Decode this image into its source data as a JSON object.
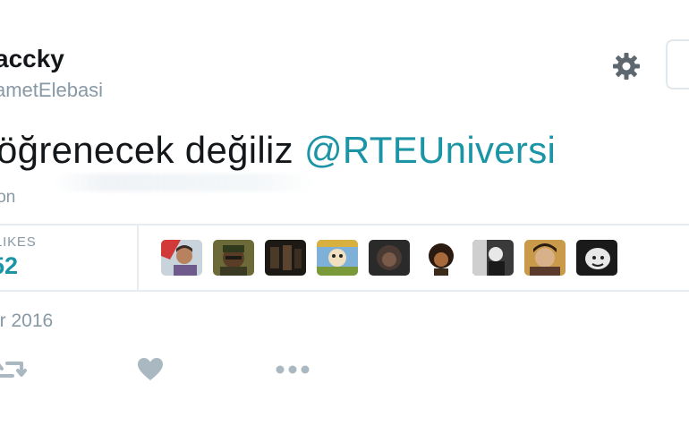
{
  "profile": {
    "display_name": "accky",
    "handle": "ametElebasi"
  },
  "tweet": {
    "text_before": "öğrenecek değiliz ",
    "mention": "@RTEUniversi",
    "translate_label": "ion"
  },
  "stats": {
    "likes_label": "LIKES",
    "likes_count": "52",
    "liker_avatars": [
      "avatar-1",
      "avatar-2",
      "avatar-3",
      "avatar-4",
      "avatar-5",
      "avatar-6",
      "avatar-7",
      "avatar-8",
      "avatar-9"
    ]
  },
  "meta": {
    "date": "or 2016"
  },
  "actions": {
    "icons": [
      "retweet-icon",
      "heart-icon",
      "more-icon"
    ]
  },
  "colors": {
    "accent": "#1b95a6",
    "text": "#14171a",
    "muted": "#8899a6",
    "divider": "#e6ecf0"
  }
}
